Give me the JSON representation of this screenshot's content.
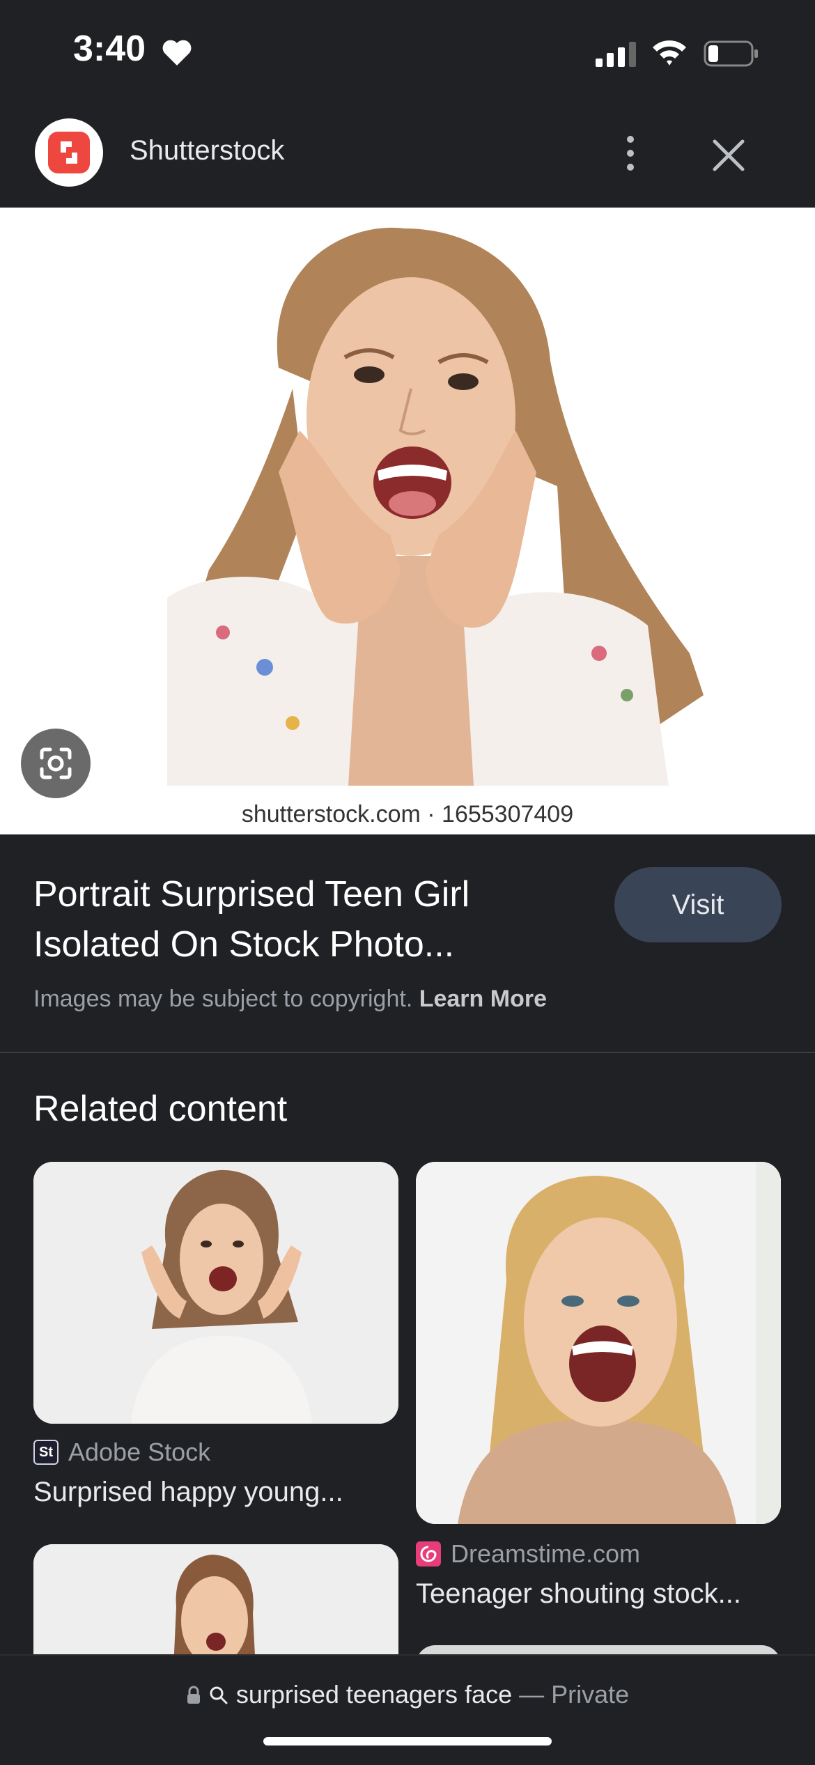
{
  "status": {
    "time": "3:40"
  },
  "header": {
    "site_name": "Shutterstock"
  },
  "image": {
    "watermark": "shutterstock.com · 1655307409"
  },
  "info": {
    "title_line1": "Portrait Surprised Teen Girl",
    "title_line2": "Isolated On Stock Photo...",
    "visit_label": "Visit",
    "copyright_text": "Images may be subject to copyright.",
    "learn_more": "Learn More"
  },
  "related": {
    "heading": "Related content",
    "items": [
      {
        "source": "Adobe Stock",
        "title": "Surprised happy young..."
      },
      {
        "source": "Dreamstime.com",
        "title": "Teenager shouting stock..."
      }
    ]
  },
  "address_bar": {
    "query": "surprised teenagers face",
    "separator": "—",
    "mode": "Private"
  },
  "colors": {
    "background": "#202124",
    "visit_button": "#394457",
    "shutterstock_red": "#ee4740",
    "dreamstime_pink": "#e73e7a"
  }
}
